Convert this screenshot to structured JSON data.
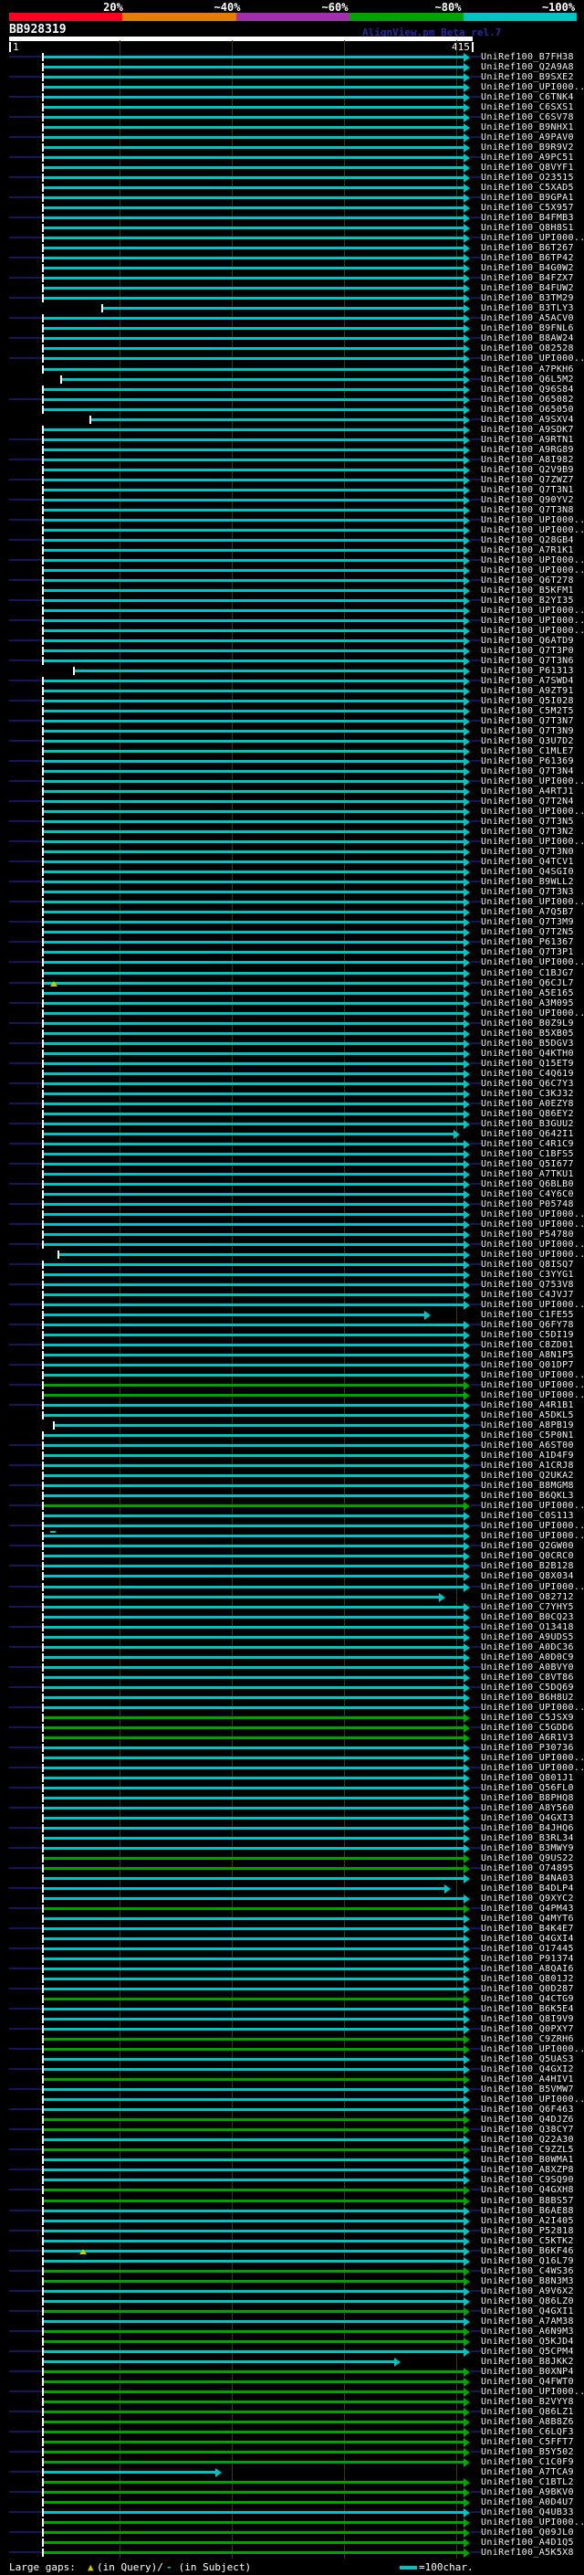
{
  "header": {
    "query_name": "BB928319",
    "watermark": "AlignView.pm Beta rel.7",
    "ruler": {
      "start_label": "1",
      "end_label": "415",
      "query_length": 415,
      "tick_every": 100
    },
    "scale_key": {
      "segments": [
        {
          "label": "20%",
          "color": "#ff0022"
        },
        {
          "label": "~40%",
          "color": "#e57d00"
        },
        {
          "label": "~60%",
          "color": "#a12fae"
        },
        {
          "label": "~80%",
          "color": "#00a400"
        },
        {
          "label": "~100%",
          "color": "#00c4c4"
        }
      ]
    }
  },
  "legend": {
    "large_gaps_label": "Large gaps: ",
    "query_gap_symbol": "▲",
    "query_gap_text": "(in Query)/",
    "subject_gap_symbol": "-",
    "subject_gap_text": " (in Subject)",
    "scalebar_label": "=100char."
  },
  "colors": {
    "cyan": "#00c4c4",
    "green": "#00a400",
    "navy": "#15155e",
    "grid": "#3c3c00",
    "label": "#f2f2f2",
    "yellow": "#d4c400",
    "white": "#ffffff",
    "watermark": "#2929a3"
  },
  "chart_data": {
    "type": "bar",
    "orientation": "horizontal",
    "title": "BB928319",
    "query_length": 415,
    "x_axis": {
      "min": 1,
      "max": 415,
      "gridline_every": 100,
      "units": "char"
    },
    "identity_color_bins": {
      "cyan": "~100%",
      "green": "~80%"
    },
    "defaults": {
      "start": 32,
      "end": 407,
      "arrow": true
    },
    "id_prefix": "UniRef100_",
    "rows": [
      [
        "B7FH38",
        "c"
      ],
      [
        "Q2A9A8",
        "c"
      ],
      [
        "B9SXE2",
        "c"
      ],
      [
        "UPI000..",
        "c"
      ],
      [
        "C6TNK4",
        "c"
      ],
      [
        "C6SXS1",
        "c"
      ],
      [
        "C6SV78",
        "c"
      ],
      [
        "B9NHX1",
        "c"
      ],
      [
        "A9PAV0",
        "c"
      ],
      [
        "B9R9V2",
        "c"
      ],
      [
        "A9PC51",
        "c"
      ],
      [
        "Q8VYF1",
        "c"
      ],
      [
        "O23515",
        "c"
      ],
      [
        "C5XAD5",
        "c"
      ],
      [
        "B9GPA1",
        "c"
      ],
      [
        "C5X957",
        "c"
      ],
      [
        "B4FMB3",
        "c"
      ],
      [
        "Q8H8S1",
        "c"
      ],
      [
        "UPI000..",
        "c"
      ],
      [
        "B6T267",
        "c"
      ],
      [
        "B6TP42",
        "c"
      ],
      [
        "B4G0W2",
        "c"
      ],
      [
        "B4FZX7",
        "c"
      ],
      [
        "B4FUW2",
        "c"
      ],
      [
        "B3TM29",
        "c"
      ],
      [
        "B3TLY3",
        "c",
        {
          "s": 85,
          "l": 0
        }
      ],
      [
        "A5ACV0",
        "c"
      ],
      [
        "B9FNL6",
        "c"
      ],
      [
        "B8AW24",
        "c"
      ],
      [
        "O82528",
        "c"
      ],
      [
        "UPI000..",
        "c"
      ],
      [
        "A7PKH6",
        "c"
      ],
      [
        "Q6L5M2",
        "c",
        {
          "s": 48,
          "l": 0
        }
      ],
      [
        "Q96S84",
        "c"
      ],
      [
        "O65082",
        "c"
      ],
      [
        "O65050",
        "c"
      ],
      [
        "A9SXV4",
        "c",
        {
          "s": 74,
          "l": 0
        }
      ],
      [
        "A9SDK7",
        "c"
      ],
      [
        "A9RTN1",
        "c"
      ],
      [
        "A9RG89",
        "c"
      ],
      [
        "A8I982",
        "c"
      ],
      [
        "Q2V9B9",
        "c"
      ],
      [
        "Q7ZWZ7",
        "c"
      ],
      [
        "Q7T3N1",
        "c"
      ],
      [
        "Q90YV2",
        "c"
      ],
      [
        "Q7T3N8",
        "c"
      ],
      [
        "UPI000..",
        "c"
      ],
      [
        "UPI000..",
        "c"
      ],
      [
        "Q28GB4",
        "c"
      ],
      [
        "A7R1K1",
        "c"
      ],
      [
        "UPI000..",
        "c"
      ],
      [
        "UPI000..",
        "c"
      ],
      [
        "Q6T278",
        "c"
      ],
      [
        "B5KFM1",
        "c"
      ],
      [
        "B2YI35",
        "c"
      ],
      [
        "UPI000..",
        "c"
      ],
      [
        "UPI000..",
        "c"
      ],
      [
        "UPI000..",
        "c"
      ],
      [
        "Q6ATD9",
        "c"
      ],
      [
        "Q7T3P0",
        "c"
      ],
      [
        "Q7T3N6",
        "c"
      ],
      [
        "P61313",
        "c",
        {
          "s": 60,
          "l": 0
        }
      ],
      [
        "A7SWD4",
        "c"
      ],
      [
        "A9ZT91",
        "c"
      ],
      [
        "Q5I028",
        "c"
      ],
      [
        "C5M2T5",
        "c"
      ],
      [
        "Q7T3N7",
        "c"
      ],
      [
        "Q7T3N9",
        "c"
      ],
      [
        "Q3U7D2",
        "c"
      ],
      [
        "C1MLE7",
        "c"
      ],
      [
        "P61369",
        "c"
      ],
      [
        "Q7T3N4",
        "c"
      ],
      [
        "UPI000..",
        "c"
      ],
      [
        "A4RTJ1",
        "c"
      ],
      [
        "Q7T2N4",
        "c"
      ],
      [
        "UPI000..",
        "c"
      ],
      [
        "Q7T3N5",
        "c"
      ],
      [
        "Q7T3N2",
        "c"
      ],
      [
        "UPI000..",
        "c"
      ],
      [
        "Q7T3N0",
        "c"
      ],
      [
        "Q4TCV1",
        "c"
      ],
      [
        "Q4SGI0",
        "c"
      ],
      [
        "B9WLL2",
        "c"
      ],
      [
        "Q7T3N3",
        "c"
      ],
      [
        "UPI000..",
        "c"
      ],
      [
        "A7Q5B7",
        "c"
      ],
      [
        "Q7T3M9",
        "c"
      ],
      [
        "Q7T2N5",
        "c"
      ],
      [
        "P61367",
        "c"
      ],
      [
        "Q7T3P1",
        "c"
      ],
      [
        "UPI000..",
        "c"
      ],
      [
        "C1BJG7",
        "c"
      ],
      [
        "Q6CJL7",
        "c",
        {
          "gq": 38
        }
      ],
      [
        "A5E165",
        "c"
      ],
      [
        "A3M095",
        "c"
      ],
      [
        "UPI000..",
        "c"
      ],
      [
        "B0Z9L9",
        "c"
      ],
      [
        "B5XB05",
        "c"
      ],
      [
        "B5DGV3",
        "c"
      ],
      [
        "Q4KTH0",
        "c"
      ],
      [
        "Q15ET9",
        "c"
      ],
      [
        "C4Q619",
        "c"
      ],
      [
        "Q6C7Y3",
        "c"
      ],
      [
        "C3KJ32",
        "c"
      ],
      [
        "A0EZY8",
        "c"
      ],
      [
        "Q86EY2",
        "c"
      ],
      [
        "B3GUU2",
        "c"
      ],
      [
        "Q642I1",
        "c",
        {
          "e": 398,
          "t": 0
        }
      ],
      [
        "C4R1C9",
        "c"
      ],
      [
        "C1BFS5",
        "c"
      ],
      [
        "Q5I677",
        "c"
      ],
      [
        "A7TKU1",
        "c"
      ],
      [
        "Q6BLB0",
        "c"
      ],
      [
        "C4Y6C0",
        "c"
      ],
      [
        "P05748",
        "c"
      ],
      [
        "UPI000..",
        "c"
      ],
      [
        "UPI000..",
        "c"
      ],
      [
        "P54780",
        "c"
      ],
      [
        "UPI000..",
        "c"
      ],
      [
        "UPI000..",
        "c",
        {
          "s": 46,
          "l": 0
        }
      ],
      [
        "Q8ISQ7",
        "c"
      ],
      [
        "C3YYG1",
        "c"
      ],
      [
        "Q753V8",
        "c"
      ],
      [
        "C4JVJ7",
        "c"
      ],
      [
        "UPI000..",
        "c"
      ],
      [
        "C1FE55",
        "c",
        {
          "e": 372,
          "t": 0
        }
      ],
      [
        "Q6FY78",
        "c"
      ],
      [
        "C5DI19",
        "c"
      ],
      [
        "C8ZD01",
        "c"
      ],
      [
        "A8N1P5",
        "c"
      ],
      [
        "Q01DP7",
        "c"
      ],
      [
        "UPI000..",
        "c"
      ],
      [
        "UPI000..",
        "g"
      ],
      [
        "UPI000..",
        "g"
      ],
      [
        "A4R1B1",
        "c"
      ],
      [
        "A5DKL5",
        "c"
      ],
      [
        "A8PB19",
        "c",
        {
          "s": 42,
          "l": 0
        }
      ],
      [
        "C5P0N1",
        "c"
      ],
      [
        "A6ST00",
        "c"
      ],
      [
        "A1D4F9",
        "c"
      ],
      [
        "A1CRJ8",
        "c"
      ],
      [
        "Q2UKA2",
        "c"
      ],
      [
        "B8MGM8",
        "c"
      ],
      [
        "B6QKL3",
        "c"
      ],
      [
        "UPI000..",
        "g"
      ],
      [
        "C0S113",
        "c"
      ],
      [
        "UPI000..",
        "c"
      ],
      [
        "UPI000..",
        "c",
        {
          "gs": 38
        }
      ],
      [
        "Q2GW00",
        "c"
      ],
      [
        "Q0CRC0",
        "c"
      ],
      [
        "B2B128",
        "c"
      ],
      [
        "Q8X034",
        "c"
      ],
      [
        "UPI000..",
        "c"
      ],
      [
        "O82712",
        "c",
        {
          "e": 385,
          "t": 0
        }
      ],
      [
        "C7YHY5",
        "c"
      ],
      [
        "B0CQ23",
        "c"
      ],
      [
        "O13418",
        "c"
      ],
      [
        "A9UDS5",
        "c"
      ],
      [
        "A0DC36",
        "c"
      ],
      [
        "A0D0C9",
        "c"
      ],
      [
        "A0BVY0",
        "c"
      ],
      [
        "C8VT86",
        "c"
      ],
      [
        "C5DQ69",
        "c"
      ],
      [
        "B6H8U2",
        "c"
      ],
      [
        "UPI000..",
        "c"
      ],
      [
        "C5JSX9",
        "g"
      ],
      [
        "C5GDD6",
        "g"
      ],
      [
        "A6R1V3",
        "g"
      ],
      [
        "P30736",
        "c"
      ],
      [
        "UPI000..",
        "c"
      ],
      [
        "UPI000..",
        "c"
      ],
      [
        "Q801J1",
        "c"
      ],
      [
        "Q56FL0",
        "c"
      ],
      [
        "B8PHQ8",
        "c"
      ],
      [
        "A8Y560",
        "c"
      ],
      [
        "Q4GXI3",
        "c"
      ],
      [
        "B4JHQ6",
        "c"
      ],
      [
        "B3RL34",
        "c"
      ],
      [
        "B3MWY9",
        "c"
      ],
      [
        "Q9US22",
        "g"
      ],
      [
        "O74895",
        "g"
      ],
      [
        "B4NA03",
        "c"
      ],
      [
        "B4DLP4",
        "c",
        {
          "e": 390,
          "t": 0
        }
      ],
      [
        "Q9XYC2",
        "c"
      ],
      [
        "Q4PM43",
        "g"
      ],
      [
        "Q4MYT6",
        "c"
      ],
      [
        "B4K4E7",
        "c"
      ],
      [
        "Q4GXI4",
        "c"
      ],
      [
        "O17445",
        "c"
      ],
      [
        "P91374",
        "c"
      ],
      [
        "A8QAI6",
        "c"
      ],
      [
        "Q801J2",
        "c"
      ],
      [
        "Q0D287",
        "c"
      ],
      [
        "Q4CTG9",
        "g"
      ],
      [
        "B6K5E4",
        "c"
      ],
      [
        "Q8I9V9",
        "c"
      ],
      [
        "Q0PXY7",
        "c"
      ],
      [
        "C9ZRH6",
        "g"
      ],
      [
        "UPI000..",
        "g"
      ],
      [
        "Q5UAS3",
        "c"
      ],
      [
        "Q4GXI2",
        "c"
      ],
      [
        "A4HIV1",
        "g"
      ],
      [
        "B5VMW7",
        "c"
      ],
      [
        "UPI000..",
        "c"
      ],
      [
        "Q6F463",
        "c"
      ],
      [
        "Q4DJZ6",
        "g"
      ],
      [
        "Q38CY7",
        "g"
      ],
      [
        "Q22A30",
        "c"
      ],
      [
        "C9ZZL5",
        "g"
      ],
      [
        "B0WMA1",
        "c"
      ],
      [
        "A8XZP8",
        "c"
      ],
      [
        "C9SQ90",
        "c"
      ],
      [
        "Q4GXH8",
        "g"
      ],
      [
        "B8BS57",
        "g"
      ],
      [
        "B6AE88",
        "c"
      ],
      [
        "A2I405",
        "c"
      ],
      [
        "P52818",
        "c"
      ],
      [
        "C5KTK2",
        "c"
      ],
      [
        "B6KF46",
        "c",
        {
          "gq": 64
        }
      ],
      [
        "Q16L79",
        "c"
      ],
      [
        "C4WS36",
        "g"
      ],
      [
        "B8N3M3",
        "g"
      ],
      [
        "A9V6X2",
        "c"
      ],
      [
        "Q86LZ0",
        "c"
      ],
      [
        "Q4GXI1",
        "g"
      ],
      [
        "A7AM38",
        "c"
      ],
      [
        "A6N9M3",
        "g"
      ],
      [
        "Q5KJD4",
        "g"
      ],
      [
        "Q5CPM4",
        "c"
      ],
      [
        "B8JKK2",
        "c",
        {
          "e": 345,
          "t": 0
        }
      ],
      [
        "B0XNP4",
        "g"
      ],
      [
        "Q4FWT0",
        "g"
      ],
      [
        "UPI000..",
        "g"
      ],
      [
        "B2VYY8",
        "g"
      ],
      [
        "Q86LZ1",
        "g"
      ],
      [
        "A8B8Z6",
        "g"
      ],
      [
        "C6LQF3",
        "g"
      ],
      [
        "C5FFT7",
        "g"
      ],
      [
        "B5Y502",
        "g"
      ],
      [
        "C1C0F9",
        "g"
      ],
      [
        "A7TCA9",
        "c",
        {
          "e": 185,
          "t": 0
        }
      ],
      [
        "C1BTL2",
        "g"
      ],
      [
        "A9BKV0",
        "g"
      ],
      [
        "A0D4U7",
        "g"
      ],
      [
        "Q4UB33",
        "c"
      ],
      [
        "UPI000..",
        "g"
      ],
      [
        "Q09JL0",
        "g"
      ],
      [
        "A4D1Q5",
        "g"
      ],
      [
        "A5K5X8",
        "g"
      ]
    ]
  }
}
